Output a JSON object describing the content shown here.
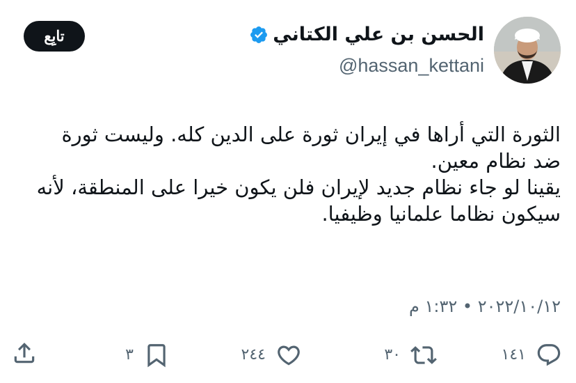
{
  "author": {
    "display_name": "الحسن بن علي الكتاني",
    "handle": "@hassan_kettani",
    "verified": true
  },
  "follow_label": "تابِع",
  "tweet": {
    "paragraphs": [
      "الثورة التي أراها في إيران ثورة على الدين كله. وليست ثورة ضد نظام معين.",
      "يقينا لو جاء نظام جديد لإيران فلن يكون خيرا على المنطقة، لأنه سيكون نظاما علمانيا وظيفيا."
    ],
    "timestamp": "٢٠٢٢/١٠/١٢ • ١:٣٢ م"
  },
  "actions": {
    "replies": "١٤١",
    "retweets": "٣٠",
    "likes": "٢٤٤",
    "bookmarks": "٣"
  },
  "colors": {
    "text": "#0f1419",
    "secondary": "#536471",
    "verified_badge": "#1d9bf0",
    "follow_button_bg": "#0f1419",
    "follow_button_text": "#ffffff"
  },
  "icons": {
    "verified": "verified-badge-icon",
    "reply": "reply-icon",
    "retweet": "retweet-icon",
    "like": "heart-icon",
    "bookmark": "bookmark-icon",
    "share": "share-icon"
  }
}
